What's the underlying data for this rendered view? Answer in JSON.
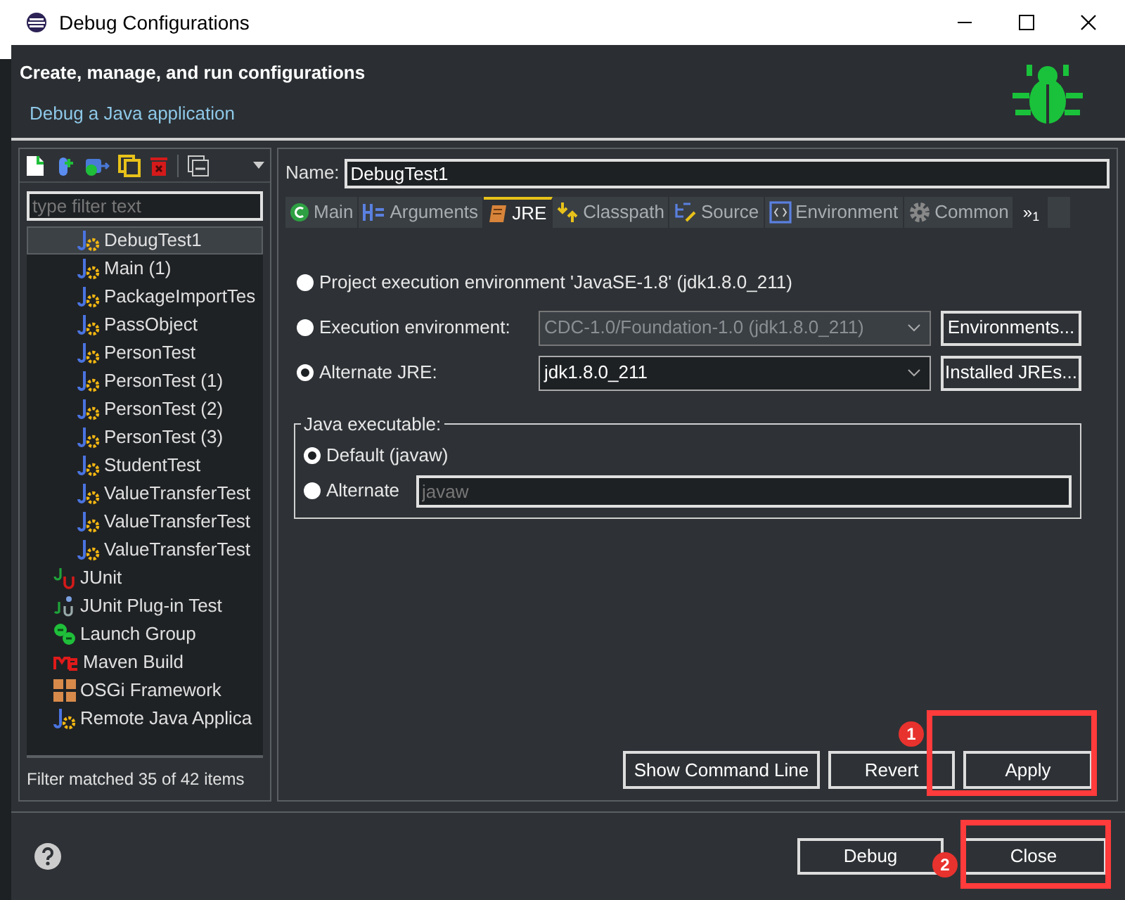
{
  "window": {
    "title": "Debug Configurations"
  },
  "header": {
    "title": "Create, manage, and run configurations",
    "subtitle": "Debug a Java application"
  },
  "filter": {
    "placeholder": "type filter text"
  },
  "tree": {
    "items": [
      {
        "children": [
          {
            "label": "DebugTest1",
            "kind": "java",
            "selected": true
          },
          {
            "label": "Main (1)",
            "kind": "java",
            "selected": false
          },
          {
            "label": "PackageImportTes",
            "kind": "java",
            "selected": false
          },
          {
            "label": "PassObject",
            "kind": "java",
            "selected": false
          },
          {
            "label": "PersonTest",
            "kind": "java",
            "selected": false
          },
          {
            "label": "PersonTest (1)",
            "kind": "java",
            "selected": false
          },
          {
            "label": "PersonTest (2)",
            "kind": "java",
            "selected": false
          },
          {
            "label": "PersonTest (3)",
            "kind": "java",
            "selected": false
          },
          {
            "label": "StudentTest",
            "kind": "java",
            "selected": false
          },
          {
            "label": "ValueTransferTest",
            "kind": "java",
            "selected": false
          },
          {
            "label": "ValueTransferTest",
            "kind": "java",
            "selected": false
          },
          {
            "label": "ValueTransferTest",
            "kind": "java",
            "selected": false
          }
        ]
      },
      {
        "label": "JUnit",
        "kind": "junit",
        "selected": false
      },
      {
        "label": "JUnit Plug-in Test",
        "kind": "junit-plugin",
        "selected": false
      },
      {
        "label": "Launch Group",
        "kind": "launch-group",
        "selected": false
      },
      {
        "label": "Maven Build",
        "kind": "maven",
        "selected": false
      },
      {
        "label": "OSGi Framework",
        "kind": "osgi",
        "selected": false
      },
      {
        "label": "Remote Java Applica",
        "kind": "java",
        "selected": false
      }
    ]
  },
  "filter_status": "Filter matched 35 of 42 items",
  "name_field": {
    "label": "Name:",
    "value": "DebugTest1"
  },
  "tabs": [
    {
      "label": "Main",
      "kind": "main",
      "selected": false
    },
    {
      "label": "Arguments",
      "kind": "arguments",
      "selected": false
    },
    {
      "label": "JRE",
      "kind": "jre",
      "selected": true
    },
    {
      "label": "Classpath",
      "kind": "classpath",
      "selected": false
    },
    {
      "label": "Source",
      "kind": "source",
      "selected": false
    },
    {
      "label": "Environment",
      "kind": "environment",
      "selected": false
    },
    {
      "label": "Common",
      "kind": "common",
      "selected": false
    }
  ],
  "tab_overflow": "»$_{1}$",
  "jre_options": [
    {
      "label": "Project execution environment 'JavaSE-1.8' (jdk1.8.0_211)",
      "selected": false
    },
    {
      "label": "Execution environment:",
      "selected": false,
      "combo": "CDC-1.0/Foundation-1.0 (jdk1.8.0_211)",
      "combo_disabled": true,
      "button": "Environments..."
    },
    {
      "label": "Alternate JRE:",
      "selected": true,
      "combo": "jdk1.8.0_211",
      "combo_disabled": false,
      "button": "Installed JREs..."
    }
  ],
  "java_executable": {
    "title": "Java executable:",
    "options": [
      {
        "label": "Default (javaw)",
        "selected": true
      },
      {
        "label": "Alternate",
        "selected": false,
        "field": "javaw",
        "field_disabled": true
      }
    ]
  },
  "panel_buttons": [
    "Show Command Line",
    "Revert",
    "Apply"
  ],
  "dialog_buttons": [
    "Debug",
    "Close"
  ],
  "annotations": [
    {
      "number": "1"
    },
    {
      "number": "2"
    }
  ]
}
